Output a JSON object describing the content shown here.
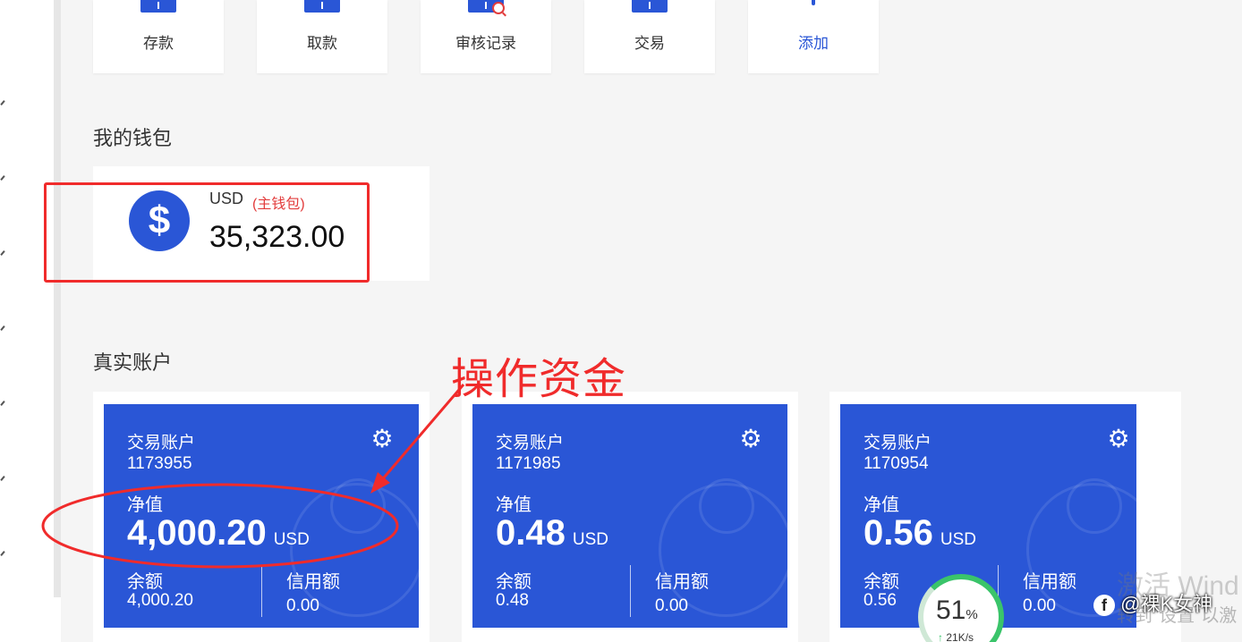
{
  "actions": [
    {
      "label": "存款"
    },
    {
      "label": "取款"
    },
    {
      "label": "审核记录"
    },
    {
      "label": "交易"
    },
    {
      "label": "添加"
    }
  ],
  "wallet_section": {
    "title": "我的钱包"
  },
  "wallet": {
    "currency": "USD",
    "tag": "(主钱包)",
    "balance": "35,323.00",
    "icon": "dollar-icon"
  },
  "accounts_section": {
    "title": "真实账户"
  },
  "annotation": {
    "text": "操作资金"
  },
  "accounts": [
    {
      "type_label": "交易账户",
      "number": "1173955",
      "equity_label": "净值",
      "equity": "4,000.20",
      "currency": "USD",
      "balance_label": "余额",
      "balance": "4,000.20",
      "credit_label": "信用额",
      "credit": "0.00"
    },
    {
      "type_label": "交易账户",
      "number": "1171985",
      "equity_label": "净值",
      "equity": "0.48",
      "currency": "USD",
      "balance_label": "余额",
      "balance": "0.48",
      "credit_label": "信用额",
      "credit": "0.00"
    },
    {
      "type_label": "交易账户",
      "number": "1170954",
      "equity_label": "净值",
      "equity": "0.56",
      "currency": "USD",
      "balance_label": "余额",
      "balance": "0.56",
      "credit_label": "信用额",
      "credit": "0.00"
    }
  ],
  "speed_widget": {
    "percent": "51",
    "percent_sign": "%",
    "rate": "21K/s"
  },
  "windows_watermark": {
    "line1": "激活 Wind",
    "line2": "转到\"设置\"以激"
  },
  "social_watermark": {
    "icon": "facebook-icon",
    "handle": "@裸K女神"
  },
  "colors": {
    "accent": "#2a56d6",
    "highlight": "#f02b2b",
    "background": "#f5f5f5"
  }
}
